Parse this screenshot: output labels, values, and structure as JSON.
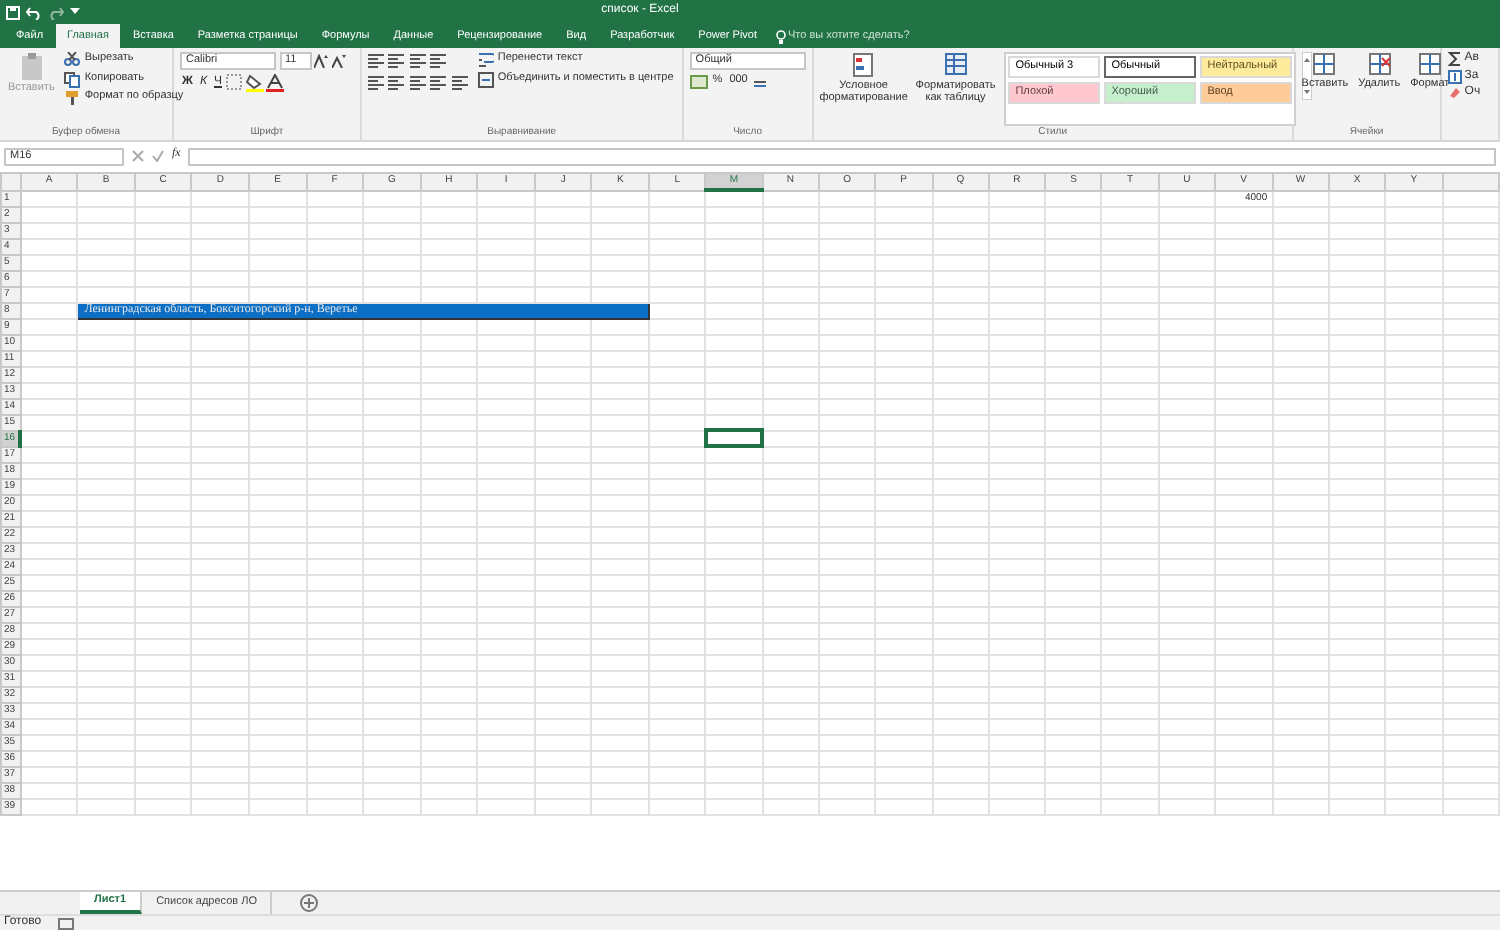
{
  "title_bar": {
    "title": "список - Excel"
  },
  "ribbon_tabs": [
    {
      "label": "Файл",
      "selected": false
    },
    {
      "label": "Главная",
      "selected": true
    },
    {
      "label": "Вставка",
      "selected": false
    },
    {
      "label": "Разметка страницы",
      "selected": false
    },
    {
      "label": "Формулы",
      "selected": false
    },
    {
      "label": "Данные",
      "selected": false
    },
    {
      "label": "Рецензирование",
      "selected": false
    },
    {
      "label": "Вид",
      "selected": false
    },
    {
      "label": "Разработчик",
      "selected": false
    },
    {
      "label": "Power Pivot",
      "selected": false
    }
  ],
  "tell_me": {
    "placeholder": "Что вы хотите сделать?"
  },
  "clipboard": {
    "paste": "Вставить",
    "cut": "Вырезать",
    "copy": "Копировать",
    "format_painter": "Формат по образцу",
    "group": "Буфер обмена"
  },
  "font": {
    "name": "Calibri",
    "size": "11",
    "bold": "Ж",
    "italic": "К",
    "underline": "Ч",
    "group": "Шрифт"
  },
  "alignment": {
    "wrap": "Перенести текст",
    "merge": "Объединить и поместить в центре",
    "group": "Выравнивание"
  },
  "number": {
    "format": "Общий",
    "percent": "%",
    "thousands": "000",
    "group": "Число"
  },
  "styles": {
    "conditional": "Условное форматирование",
    "as_table": "Форматировать как таблицу",
    "gallery": [
      {
        "label": "Обычный 3",
        "color": "#ffffff",
        "selected": false
      },
      {
        "label": "Обычный",
        "color": "#ffffff",
        "selected": true
      },
      {
        "label": "Нейтральный",
        "color": "#ffeb9c",
        "selected": false
      },
      {
        "label": "Плохой",
        "color": "#ffc7ce",
        "selected": false
      },
      {
        "label": "Хороший",
        "color": "#c6efce",
        "selected": false
      },
      {
        "label": "Ввод",
        "color": "#ffcc99",
        "selected": false
      }
    ],
    "group": "Стили"
  },
  "cells_group": {
    "buttons": [
      "Вставить",
      "Удалить",
      "Формат"
    ],
    "group": "Ячейки"
  },
  "editing": {
    "items": [
      "Ав",
      "За",
      "Оч"
    ]
  },
  "formula_bar": {
    "name_box": "M16",
    "fx": "fx"
  },
  "sheet": {
    "columns": [
      "A",
      "B",
      "C",
      "D",
      "E",
      "F",
      "G",
      "H",
      "I",
      "J",
      "K",
      "L",
      "M",
      "N",
      "O",
      "P",
      "Q",
      "R",
      "S",
      "T",
      "U",
      "V",
      "W",
      "X",
      "Y"
    ],
    "rows": [
      {
        "label": "1",
        "cells": {
          "V": {
            "value": "4000"
          }
        }
      },
      {
        "label": "2"
      },
      {
        "label": "3"
      },
      {
        "label": "4"
      },
      {
        "label": "5"
      },
      {
        "label": "6"
      },
      {
        "label": "7"
      },
      {
        "label": "8",
        "cells": {
          "B:K": {
            "value": "Ленинградская область, Бокситогорский р-н, Веретье",
            "color": "#0b6fc6"
          }
        }
      },
      {
        "label": "9"
      },
      {
        "label": "10"
      },
      {
        "label": "11"
      },
      {
        "label": "12"
      },
      {
        "label": "13"
      },
      {
        "label": "14"
      },
      {
        "label": "15"
      },
      {
        "label": "16",
        "cells": {
          "M": {
            "selected": true
          }
        }
      },
      {
        "label": "17"
      },
      {
        "label": "18"
      },
      {
        "label": "19"
      },
      {
        "label": "20"
      },
      {
        "label": "21"
      },
      {
        "label": "22"
      },
      {
        "label": "23"
      },
      {
        "label": "24"
      },
      {
        "label": "25"
      },
      {
        "label": "26"
      },
      {
        "label": "27"
      },
      {
        "label": "28"
      },
      {
        "label": "29"
      },
      {
        "label": "30"
      },
      {
        "label": "31"
      },
      {
        "label": "32"
      },
      {
        "label": "33"
      },
      {
        "label": "34"
      },
      {
        "label": "35"
      },
      {
        "label": "36"
      },
      {
        "label": "37"
      },
      {
        "label": "38"
      },
      {
        "label": "39"
      }
    ]
  },
  "sheet_tabs": [
    {
      "label": "Лист1",
      "selected": true
    },
    {
      "label": "Список адресов ЛО",
      "selected": false
    }
  ],
  "status_bar": {
    "status": "Готово"
  }
}
